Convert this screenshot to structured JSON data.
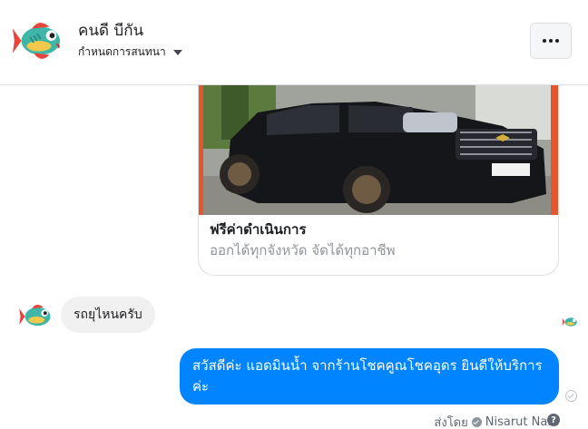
{
  "header": {
    "name": "คนดี บีกัน",
    "subtitle": "กำหนดการสนทนา",
    "avatar_icon": "fish-icon",
    "more_icon": "more-dots-icon"
  },
  "card": {
    "image_icon": "pickup-truck-photo",
    "title": "ฟรีค่าดำเนินการ",
    "description": "ออกได้ทุกจังหวัด จัดได้ทุกอาชีพ"
  },
  "messages": {
    "incoming": "รถยุไหนครับ",
    "outgoing": "สวัสดีค่ะ แอดมินน้ำ จากร้านโชคคูณโชคอุดร ยินดีให้บริการค่ะ",
    "sent_by_label": "ส่งโดย",
    "sender_name": "Nisarut Nam",
    "help_glyph": "?"
  },
  "colors": {
    "outgoing_bubble": "#0084ff",
    "incoming_bubble": "#f1f0f0",
    "card_accent": "#e4572e"
  }
}
